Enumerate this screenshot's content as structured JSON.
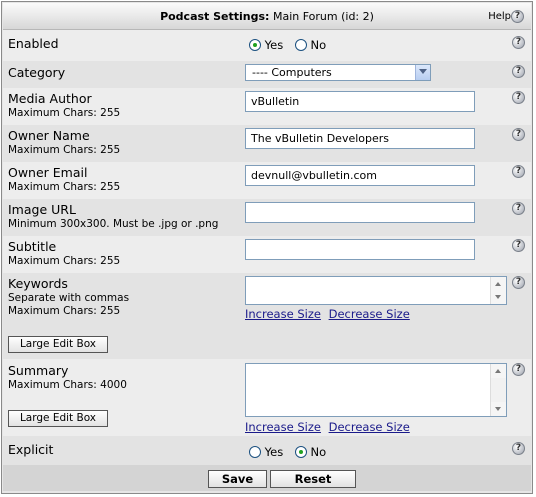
{
  "header": {
    "title_bold": "Podcast Settings:",
    "title_rest": " Main Forum (id: 2)",
    "help_label": "Help"
  },
  "help_icon_glyph": "?",
  "enabled": {
    "label": "Enabled",
    "options": [
      "Yes",
      "No"
    ],
    "selected": "Yes"
  },
  "category": {
    "label": "Category",
    "value": "---- Computers"
  },
  "media_author": {
    "label": "Media Author",
    "hint": "Maximum Chars: 255",
    "value": "vBulletin"
  },
  "owner_name": {
    "label": "Owner Name",
    "hint": "Maximum Chars: 255",
    "value": "The vBulletin Developers"
  },
  "owner_email": {
    "label": "Owner Email",
    "hint": "Maximum Chars: 255",
    "value": "devnull@vbulletin.com"
  },
  "image_url": {
    "label": "Image URL",
    "hint": "Minimum 300x300. Must be .jpg or .png",
    "value": ""
  },
  "subtitle": {
    "label": "Subtitle",
    "hint": "Maximum Chars: 255",
    "value": ""
  },
  "keywords": {
    "label": "Keywords",
    "hint1": "Separate with commas",
    "hint2": "Maximum Chars: 255",
    "value": "",
    "large_edit": "Large Edit Box",
    "increase": "Increase Size",
    "decrease": "Decrease Size"
  },
  "summary": {
    "label": "Summary",
    "hint": "Maximum Chars: 4000",
    "value": "",
    "large_edit": "Large Edit Box",
    "increase": "Increase Size",
    "decrease": "Decrease Size"
  },
  "explicit": {
    "label": "Explicit",
    "options": [
      "Yes",
      "No"
    ],
    "selected": "No"
  },
  "footer": {
    "save": "Save",
    "reset": "Reset"
  },
  "colors": {
    "radio_dot": "#21a121",
    "link": "#1a1a8a",
    "input_border": "#7f9db9"
  }
}
